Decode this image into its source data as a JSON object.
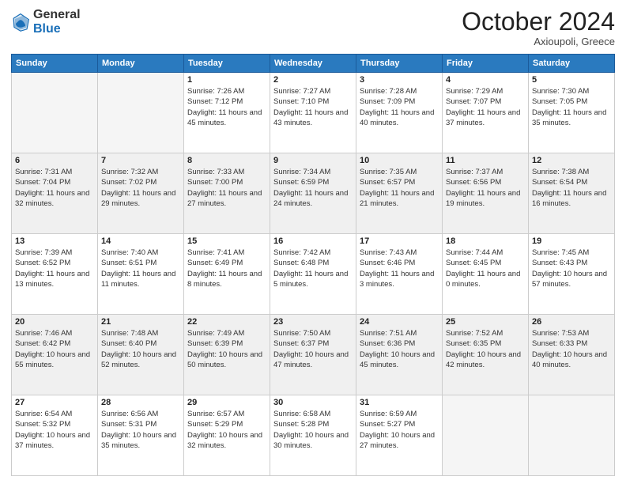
{
  "header": {
    "logo_general": "General",
    "logo_blue": "Blue",
    "month_title": "October 2024",
    "subtitle": "Axioupoli, Greece"
  },
  "days_of_week": [
    "Sunday",
    "Monday",
    "Tuesday",
    "Wednesday",
    "Thursday",
    "Friday",
    "Saturday"
  ],
  "weeks": [
    [
      {
        "num": "",
        "info": ""
      },
      {
        "num": "",
        "info": ""
      },
      {
        "num": "1",
        "info": "Sunrise: 7:26 AM\nSunset: 7:12 PM\nDaylight: 11 hours and 45 minutes."
      },
      {
        "num": "2",
        "info": "Sunrise: 7:27 AM\nSunset: 7:10 PM\nDaylight: 11 hours and 43 minutes."
      },
      {
        "num": "3",
        "info": "Sunrise: 7:28 AM\nSunset: 7:09 PM\nDaylight: 11 hours and 40 minutes."
      },
      {
        "num": "4",
        "info": "Sunrise: 7:29 AM\nSunset: 7:07 PM\nDaylight: 11 hours and 37 minutes."
      },
      {
        "num": "5",
        "info": "Sunrise: 7:30 AM\nSunset: 7:05 PM\nDaylight: 11 hours and 35 minutes."
      }
    ],
    [
      {
        "num": "6",
        "info": "Sunrise: 7:31 AM\nSunset: 7:04 PM\nDaylight: 11 hours and 32 minutes."
      },
      {
        "num": "7",
        "info": "Sunrise: 7:32 AM\nSunset: 7:02 PM\nDaylight: 11 hours and 29 minutes."
      },
      {
        "num": "8",
        "info": "Sunrise: 7:33 AM\nSunset: 7:00 PM\nDaylight: 11 hours and 27 minutes."
      },
      {
        "num": "9",
        "info": "Sunrise: 7:34 AM\nSunset: 6:59 PM\nDaylight: 11 hours and 24 minutes."
      },
      {
        "num": "10",
        "info": "Sunrise: 7:35 AM\nSunset: 6:57 PM\nDaylight: 11 hours and 21 minutes."
      },
      {
        "num": "11",
        "info": "Sunrise: 7:37 AM\nSunset: 6:56 PM\nDaylight: 11 hours and 19 minutes."
      },
      {
        "num": "12",
        "info": "Sunrise: 7:38 AM\nSunset: 6:54 PM\nDaylight: 11 hours and 16 minutes."
      }
    ],
    [
      {
        "num": "13",
        "info": "Sunrise: 7:39 AM\nSunset: 6:52 PM\nDaylight: 11 hours and 13 minutes."
      },
      {
        "num": "14",
        "info": "Sunrise: 7:40 AM\nSunset: 6:51 PM\nDaylight: 11 hours and 11 minutes."
      },
      {
        "num": "15",
        "info": "Sunrise: 7:41 AM\nSunset: 6:49 PM\nDaylight: 11 hours and 8 minutes."
      },
      {
        "num": "16",
        "info": "Sunrise: 7:42 AM\nSunset: 6:48 PM\nDaylight: 11 hours and 5 minutes."
      },
      {
        "num": "17",
        "info": "Sunrise: 7:43 AM\nSunset: 6:46 PM\nDaylight: 11 hours and 3 minutes."
      },
      {
        "num": "18",
        "info": "Sunrise: 7:44 AM\nSunset: 6:45 PM\nDaylight: 11 hours and 0 minutes."
      },
      {
        "num": "19",
        "info": "Sunrise: 7:45 AM\nSunset: 6:43 PM\nDaylight: 10 hours and 57 minutes."
      }
    ],
    [
      {
        "num": "20",
        "info": "Sunrise: 7:46 AM\nSunset: 6:42 PM\nDaylight: 10 hours and 55 minutes."
      },
      {
        "num": "21",
        "info": "Sunrise: 7:48 AM\nSunset: 6:40 PM\nDaylight: 10 hours and 52 minutes."
      },
      {
        "num": "22",
        "info": "Sunrise: 7:49 AM\nSunset: 6:39 PM\nDaylight: 10 hours and 50 minutes."
      },
      {
        "num": "23",
        "info": "Sunrise: 7:50 AM\nSunset: 6:37 PM\nDaylight: 10 hours and 47 minutes."
      },
      {
        "num": "24",
        "info": "Sunrise: 7:51 AM\nSunset: 6:36 PM\nDaylight: 10 hours and 45 minutes."
      },
      {
        "num": "25",
        "info": "Sunrise: 7:52 AM\nSunset: 6:35 PM\nDaylight: 10 hours and 42 minutes."
      },
      {
        "num": "26",
        "info": "Sunrise: 7:53 AM\nSunset: 6:33 PM\nDaylight: 10 hours and 40 minutes."
      }
    ],
    [
      {
        "num": "27",
        "info": "Sunrise: 6:54 AM\nSunset: 5:32 PM\nDaylight: 10 hours and 37 minutes."
      },
      {
        "num": "28",
        "info": "Sunrise: 6:56 AM\nSunset: 5:31 PM\nDaylight: 10 hours and 35 minutes."
      },
      {
        "num": "29",
        "info": "Sunrise: 6:57 AM\nSunset: 5:29 PM\nDaylight: 10 hours and 32 minutes."
      },
      {
        "num": "30",
        "info": "Sunrise: 6:58 AM\nSunset: 5:28 PM\nDaylight: 10 hours and 30 minutes."
      },
      {
        "num": "31",
        "info": "Sunrise: 6:59 AM\nSunset: 5:27 PM\nDaylight: 10 hours and 27 minutes."
      },
      {
        "num": "",
        "info": ""
      },
      {
        "num": "",
        "info": ""
      }
    ]
  ]
}
